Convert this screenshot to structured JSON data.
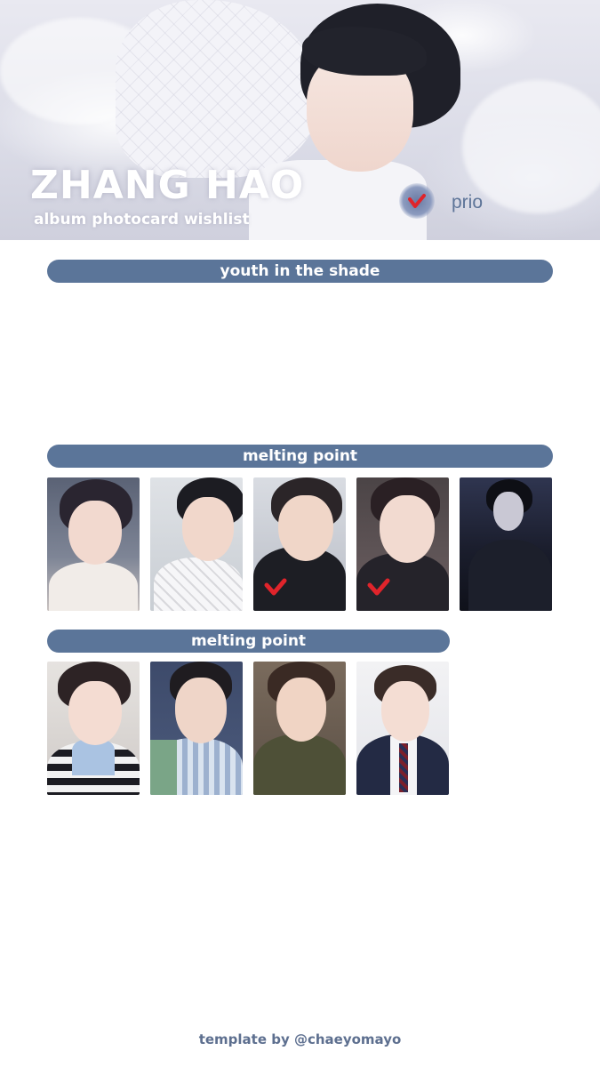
{
  "header": {
    "title": "ZHANG HAO",
    "subtitle": "album photocard wishlist",
    "prio_label": "prio",
    "prio_icon": "check-icon",
    "check_color": "#e0242b"
  },
  "sections": [
    {
      "title": "youth in the shade",
      "cards": []
    },
    {
      "title": "melting point",
      "cards": [
        {
          "name": "photocard-1",
          "prio": false
        },
        {
          "name": "photocard-2",
          "prio": false
        },
        {
          "name": "photocard-3",
          "prio": true
        },
        {
          "name": "photocard-4",
          "prio": true
        },
        {
          "name": "photocard-5",
          "prio": false
        }
      ]
    },
    {
      "title": "melting point",
      "cards": [
        {
          "name": "photocard-1",
          "prio": false
        },
        {
          "name": "photocard-2",
          "prio": false
        },
        {
          "name": "photocard-3",
          "prio": false
        },
        {
          "name": "photocard-4",
          "prio": false
        }
      ]
    }
  ],
  "footer": "template by @chaeyomayo",
  "colors": {
    "accent": "#5b7599",
    "prio_text": "#5d7498"
  }
}
